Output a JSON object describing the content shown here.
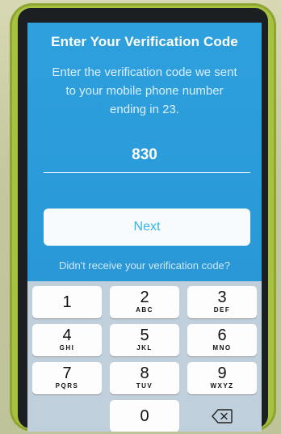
{
  "screen": {
    "title": "Enter Your Verification Code",
    "subtitle": "Enter the verification code we sent to your mobile phone number ending in 23.",
    "code_value": "830",
    "next_label": "Next",
    "resend_text": "Didn't receive your verification code?"
  },
  "keypad": {
    "keys": [
      {
        "digit": "1",
        "letters": ""
      },
      {
        "digit": "2",
        "letters": "ABC"
      },
      {
        "digit": "3",
        "letters": "DEF"
      },
      {
        "digit": "4",
        "letters": "GHI"
      },
      {
        "digit": "5",
        "letters": "JKL"
      },
      {
        "digit": "6",
        "letters": "MNO"
      },
      {
        "digit": "7",
        "letters": "PQRS"
      },
      {
        "digit": "8",
        "letters": "TUV"
      },
      {
        "digit": "9",
        "letters": "WXYZ"
      },
      {
        "digit": "0",
        "letters": ""
      }
    ],
    "delete_icon": "backspace-icon"
  },
  "colors": {
    "screen_blue": "#2a9ad8",
    "button_text": "#36b5e6",
    "case_green": "#a7c23f"
  }
}
